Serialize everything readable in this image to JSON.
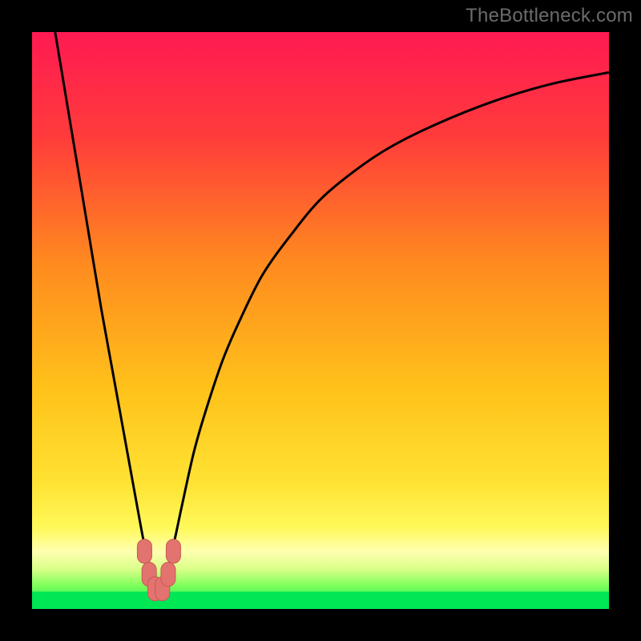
{
  "watermark": "TheBottleneck.com",
  "colors": {
    "frame": "#000000",
    "curve": "#000000",
    "green_band": "#00e756",
    "marker_fill": "#e2736e",
    "marker_stroke": "#c95a55",
    "gradient_stops": [
      {
        "offset": "0%",
        "color": "#ff1a52"
      },
      {
        "offset": "18%",
        "color": "#ff3b3b"
      },
      {
        "offset": "40%",
        "color": "#ff8a1f"
      },
      {
        "offset": "62%",
        "color": "#ffc21a"
      },
      {
        "offset": "78%",
        "color": "#ffe233"
      },
      {
        "offset": "86%",
        "color": "#fff95a"
      },
      {
        "offset": "90%",
        "color": "#ffffb0"
      },
      {
        "offset": "93%",
        "color": "#dcff8a"
      },
      {
        "offset": "96%",
        "color": "#7dff5a"
      },
      {
        "offset": "100%",
        "color": "#00e756"
      }
    ]
  },
  "chart_data": {
    "type": "line",
    "title": "",
    "xlabel": "",
    "ylabel": "",
    "xlim": [
      0,
      100
    ],
    "ylim": [
      0,
      100
    ],
    "x_optimum": 22,
    "series": [
      {
        "name": "bottleneck-curve",
        "x": [
          4,
          6,
          8,
          10,
          12,
          14,
          16,
          18,
          19.5,
          21,
          22,
          23,
          24.5,
          26,
          28,
          30,
          33,
          36,
          40,
          45,
          50,
          56,
          62,
          70,
          80,
          90,
          100
        ],
        "y": [
          100,
          88,
          76,
          64,
          52,
          41,
          30,
          19,
          11,
          5,
          2,
          5,
          11,
          18,
          27,
          34,
          43,
          50,
          58,
          65,
          71,
          76,
          80,
          84,
          88,
          91,
          93
        ]
      }
    ],
    "markers": {
      "name": "near-optimum-points",
      "x": [
        19.5,
        20.3,
        21.3,
        22.6,
        23.6,
        24.5
      ],
      "y": [
        10.0,
        6.0,
        3.5,
        3.5,
        6.0,
        10.0
      ]
    }
  }
}
